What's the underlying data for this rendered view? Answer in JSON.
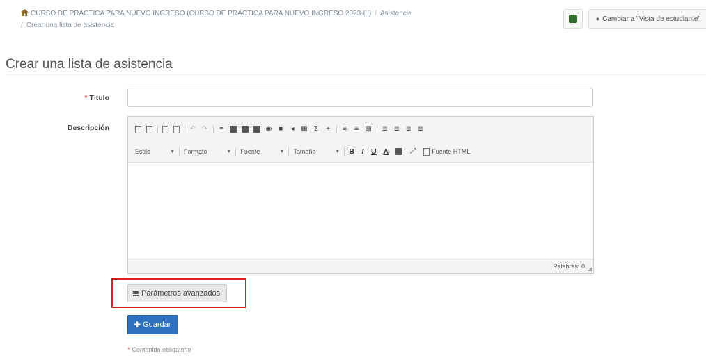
{
  "breadcrumb": {
    "course": "CURSO DE PRÁCTICA PARA NUEVO INGRESO (CURSO DE PRÁCTICA PARA NUEVO INGRESO 2023-III)",
    "section": "Asistencia",
    "current": "Crear una lista de asistencia"
  },
  "top_right": {
    "switch_label": "Cambiar a \"Vista de estudiante\""
  },
  "page": {
    "title": "Crear una lista de asistencia"
  },
  "form": {
    "title_label": "Título",
    "title_value": "",
    "description_label": "Descripción",
    "toolbar": {
      "style_combo": "Estilo",
      "format_combo": "Formato",
      "font_combo": "Fuente",
      "size_combo": "Tamaño",
      "bold": "B",
      "italic": "I",
      "underline": "U",
      "text_color": "A",
      "source_label": "Fuente HTML"
    },
    "word_count": "Palabras: 0",
    "advanced_button": "Parámetros avanzados",
    "save_button": "Guardar",
    "required_note": "Contenido obligatorio"
  },
  "colors": {
    "primary_button": "#2f6fbf",
    "highlight_border": "#e02020",
    "required_mark": "#d9534f"
  },
  "icons": {
    "home": "home-icon",
    "student_view": "student-view-icon",
    "eye": "eye-icon",
    "advanced": "bars-icon",
    "save": "plus-icon"
  }
}
